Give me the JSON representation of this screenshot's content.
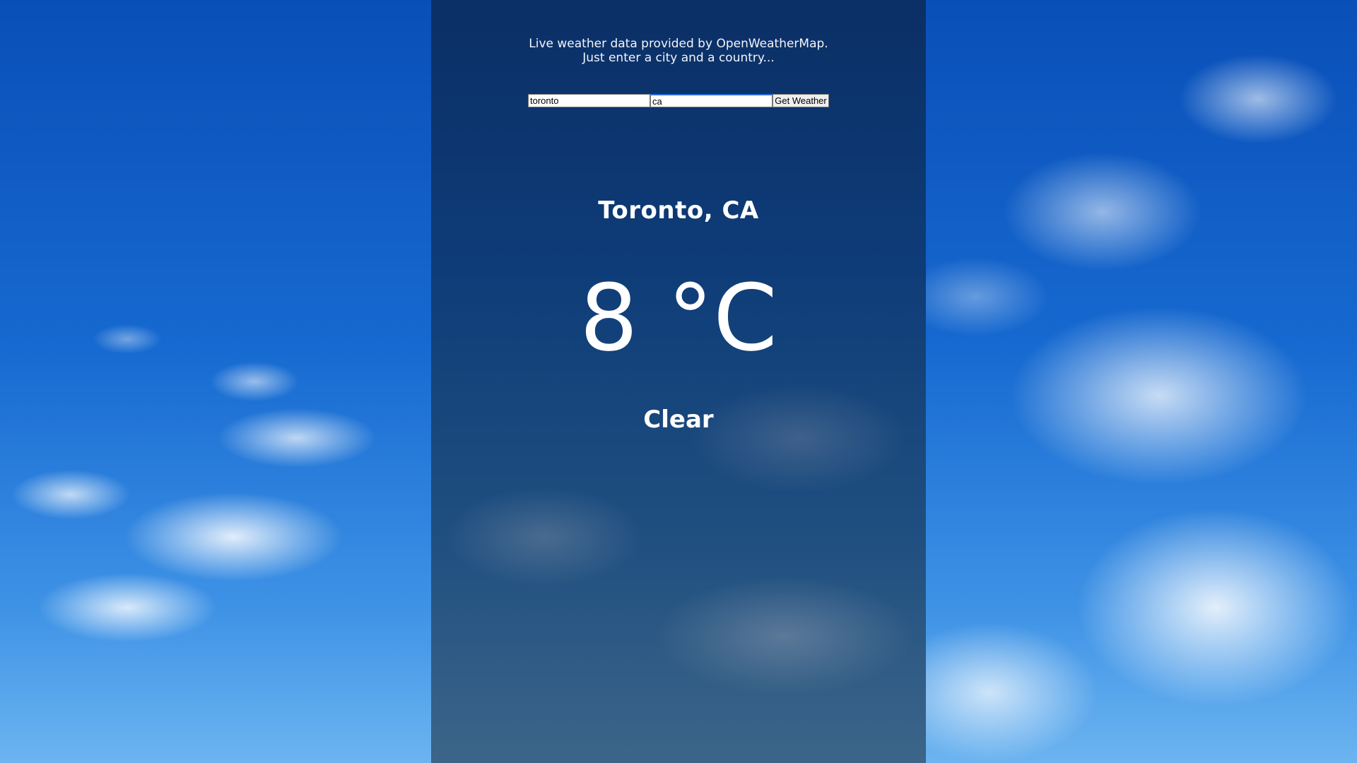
{
  "intro": {
    "line1": "Live weather data provided by OpenWeatherMap.",
    "line2": "Just enter a city and a country..."
  },
  "form": {
    "city_value": "toronto",
    "country_value": "ca",
    "submit_label": "Get Weather"
  },
  "weather": {
    "location": "Toronto, CA",
    "temperature": "8 °C",
    "description": "Clear"
  }
}
